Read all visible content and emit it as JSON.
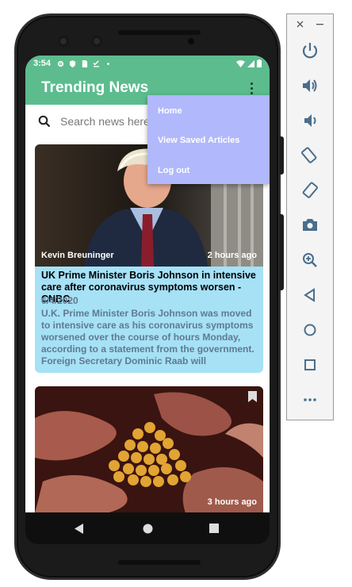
{
  "status_bar": {
    "time": "3:54"
  },
  "app_bar": {
    "title": "Trending News"
  },
  "search": {
    "placeholder": "Search news here"
  },
  "overflow_menu": {
    "items": [
      {
        "label": "Home"
      },
      {
        "label": "View Saved Articles"
      },
      {
        "label": "Log out"
      }
    ]
  },
  "articles": [
    {
      "author": "Kevin Breuninger",
      "age": "2 hours ago",
      "headline": "UK Prime Minister Boris Johnson in intensive care after coronavirus symptoms worsen - CNBC",
      "date": "6/4/2020",
      "description": "U.K. Prime Minister Boris Johnson was moved to intensive care as his coronavirus symptoms worsened over the course of hours Monday, according to a statement from the government. Foreign Secretary Dominic Raab will"
    },
    {
      "author": "",
      "age": "3 hours ago"
    }
  ],
  "colors": {
    "app_bar": "#5cbc8e",
    "card": "#a6e1f6",
    "menu": "#b1b8fb",
    "card_text": "#5f7a90"
  }
}
